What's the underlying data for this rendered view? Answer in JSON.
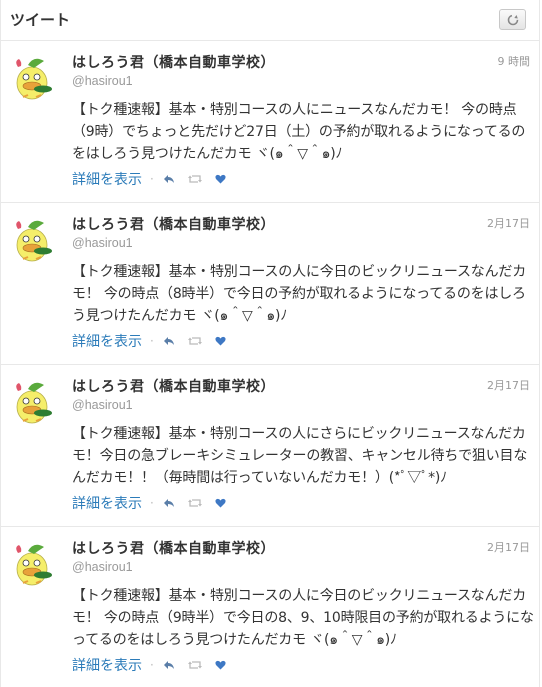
{
  "header": {
    "title": "ツイート",
    "refresh_icon": "refresh-icon"
  },
  "colors": {
    "link": "#2b7bb9",
    "text": "#333333",
    "muted": "#999999",
    "avatar_body": "#f5ee6a",
    "avatar_leaf": "#5aaa3c"
  },
  "tweets": [
    {
      "name": "はしろう君（橋本自動車学校）",
      "handle": "@hasirou1",
      "time": "9 時間",
      "text": "【トク種速報】基本・特別コースの人にニュースなんだカモ！ 今の時点（9時）でちょっと先だけど27日（土）の予約が取れるようになってるのをはしろう見つけたんだカモ ヾ(๑＾▽＾๑)ﾉ",
      "detail": "詳細を表示",
      "separator": "·"
    },
    {
      "name": "はしろう君（橋本自動車学校）",
      "handle": "@hasirou1",
      "time": "2月17日",
      "text": "【トク種速報】基本・特別コースの人に今日のビックリニュースなんだカモ！ 今の時点（8時半）で今日の予約が取れるようになってるのをはしろう見つけたんだカモ ヾ(๑＾▽＾๑)ﾉ",
      "detail": "詳細を表示",
      "separator": "·"
    },
    {
      "name": "はしろう君（橋本自動車学校）",
      "handle": "@hasirou1",
      "time": "2月17日",
      "text": "【トク種速報】基本・特別コースの人にさらにビックリニュースなんだカモ！今日の急ブレーキシミュレーターの教習、キャンセル待ちで狙い目なんだカモ！！（毎時間は行っていないんだカモ！）(*ﾟ▽ﾟ*)ﾉ",
      "detail": "詳細を表示",
      "separator": "·"
    },
    {
      "name": "はしろう君（橋本自動車学校）",
      "handle": "@hasirou1",
      "time": "2月17日",
      "text": "【トク種速報】基本・特別コースの人に今日のビックリニュースなんだカモ！ 今の時点（9時半）で今日の8、9、10時限目の予約が取れるようになってるのをはしろう見つけたんだカモ ヾ(๑＾▽＾๑)ﾉ",
      "detail": "詳細を表示",
      "separator": "·"
    }
  ],
  "icons": {
    "reply": "reply-icon",
    "retweet": "retweet-icon",
    "favorite": "favorite-icon",
    "avatar": "duck-avatar"
  }
}
